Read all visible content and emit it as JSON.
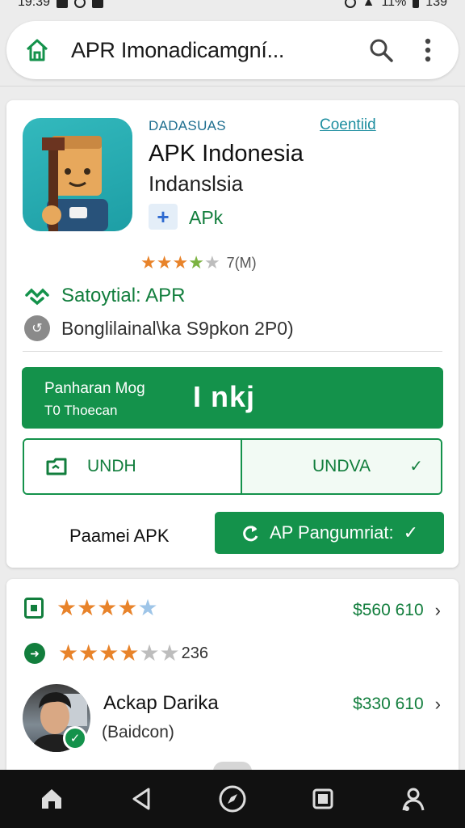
{
  "status_bar": {
    "time": "19:39",
    "battery": "11%",
    "signal_text": "139"
  },
  "address_bar": {
    "url_text": "APR Imonadicamgní...",
    "icons": [
      "home-icon",
      "search-icon",
      "more-vert-icon"
    ]
  },
  "app": {
    "developer": "DADASUAS",
    "contact_link": "Coentiid",
    "title": "APK Indonesia",
    "subtitle": "Indanslsia",
    "badge_symbol": "+",
    "badge_label": "APk",
    "rating_count": "7(M)",
    "rating_stars": 3.5,
    "version_text": "Satoytial: APR",
    "size_text": "Bonglilainal\\ka S9pkon 2P0)"
  },
  "download_main": {
    "line1": "Panharan Mog",
    "line2": "T0 Thoecan",
    "big_text": "I nkj"
  },
  "split_button": {
    "left_label": "UNDH",
    "right_label": "UNDVA",
    "chevron": "✓"
  },
  "secondary": {
    "left_text": "Paamei APK",
    "button_label": "AP Pangumriat:",
    "button_check": "✓"
  },
  "reviews": [
    {
      "stars_on": 4,
      "stars_total": 5,
      "count": "",
      "price": "$560 610",
      "arrow": "›"
    },
    {
      "stars_on": 4,
      "stars_total": 6,
      "count": "236",
      "price": "",
      "arrow": ""
    },
    {
      "name": "Ackap Darika",
      "sub": "(Baidcon)",
      "price": "$330 610",
      "arrow": "›"
    }
  ],
  "colors": {
    "brand_green": "#14924b",
    "text_green": "#127e3d",
    "star_orange": "#e8832a",
    "star_blue": "#9ec5e8"
  },
  "nav_bar": [
    "home-icon",
    "back-icon",
    "compass-icon",
    "recents-icon",
    "account-icon"
  ]
}
